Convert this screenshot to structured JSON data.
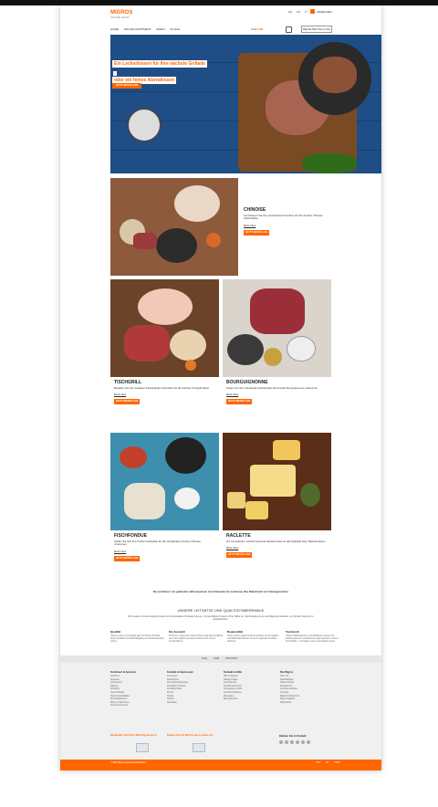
{
  "header": {
    "logo": "MIGROS",
    "logo_sub": "ONLINE-SHOP",
    "languages": [
      "DE",
      "FR",
      "IT"
    ],
    "login": "ANMELDEN",
    "nav": [
      "HOME",
      "ONLINE-SORTIMENT",
      "IDEEN",
      "FILIALE"
    ],
    "vat_label": "Total",
    "vat_value": "0.00",
    "cart_count": "0",
    "store_button": "MEINE BESTELLUNG"
  },
  "hero": {
    "title_line1": "Ein Leckerbissen für Ihre nächste Grillade",
    "title_line2": "oder ein feines Abendessen",
    "arrow": "›",
    "button": "JETZT BESTELLEN"
  },
  "feature": {
    "title": "CHINOISE",
    "desc": "Kombinieren Sie Ihre persönlichen Favoriten für Ihre Fondue Chinoise Fleischplatte.",
    "more": "Mehr Infos",
    "button": "JETZT BESTELLEN"
  },
  "cards": [
    {
      "title": "TISCHGRILL",
      "desc": "Bestellen Sie Ihre perfekten Fleischplatte nach Mass für die nächste Tischgrill-Party!",
      "more": "Mehr Infos",
      "button": "JETZT BESTELLEN"
    },
    {
      "title": "BOURGUIGNONNE",
      "desc": "Stellen Sie Ihre individuelle Fleischplatte fürs Fondue Bourguignonne zusammen.",
      "more": "Mehr Infos",
      "button": "JETZT BESTELLEN"
    },
    {
      "title": "FISCHFONDUE",
      "desc": "Stellen Sie sich Ihre frische Fischplatte für die einzigartiges Fondue Chinoise zusammen.",
      "more": "Mehr Infos",
      "button": "JETZT BESTELLEN"
    },
    {
      "title": "RACLETTE",
      "desc": "Zur aromatische, weltschmelzende Raclette-Käse ist das Highlight beim Raclette-Essen.",
      "more": "Mehr Infos",
      "button": "JETZT BESTELLEN"
    }
  ],
  "note": "Sie profitieren von geltenden Aktionspreisen zum Zeitpunkt der Lieferung. Das Rabatt wird erst hinzugerechnet.",
  "values_section": {
    "title": "UNSERE LEITSÄTZE UND QUALITÄTSMERKMALE",
    "desc": "Mit unserem Online-Angebot bieten wir verschiedene Produkte fürs an, mit das Migros Vorteil in Ihrer Nähe an. Gleichzeitig ist uns auf folgende Leitsätze, um Kunden Service zu gewährleisten.",
    "items": [
      {
        "title": "Qualität",
        "desc": "Unsere Liebe zum Produkt geht mit frische Produkt, bester Qualität und Nachhaltigkeit pro Verkaufsstandort einher."
      },
      {
        "title": "Die Auswahl",
        "desc": "Wir bieten neben den besten Preis-Leistungs-Verhältnis auch als möglichst grosses Sortiment für unsere Kundschaft an."
      },
      {
        "title": "Regionalität",
        "desc": "Viele unserer engen Zusammenarbeit mit der lokalen Landwirtschaft können wir auch regionale Produkte anbieten."
      },
      {
        "title": "Teamwork",
        "desc": "Unsere Mitarbeitenden und Mitarbeiter werden mit Fachkompetenz und Menschen das Vertrauen unserer Kundschaft – und tragen unsere Grundsätze weiter."
      }
    ]
  },
  "midbar": {
    "links": [
      "FAQ",
      "AGB",
      "KONTAKT"
    ]
  },
  "footer": {
    "columns": [
      {
        "title": "Sortiment & Services",
        "items": [
          "Sortiment",
          "Angebote",
          "Lieferservice",
          "Zahlung",
          "Abholung",
          "Geschenkkarte",
          "Fleisch Spezialitäten",
          "Brot & Backwaren",
          "Weine & Spirituosen",
          "Früchte & Gemüse"
        ]
      },
      {
        "title": "Kontakt & Impressum",
        "items": [
          "Impressum",
          "Datenschutz",
          "Nutzungsbedingungen",
          "Rechtliche Hinweise",
          "Kontaktformular",
          "Presse",
          "Medien",
          "Karriere",
          "Newsletter"
        ]
      },
      {
        "title": "Kontakt & Hilfe",
        "items": [
          "Hilfe & Support",
          "Häufige Fragen",
          "Kundendienst",
          "Kontakt aufnehmen",
          "Anregungen & Kritik",
          "Lieferinformationen",
          "Rückgaben",
          "Barrierefreiheit"
        ]
      },
      {
        "title": "Die Migros",
        "items": [
          "Über uns",
          "Nachhaltigkeit",
          "Migros-Gruppe",
          "Engagement",
          "Genossenschaften",
          "Cumulus",
          "Migros-Kulturprozent",
          "Migros Magazin",
          "Migros-Blog"
        ]
      }
    ],
    "promo1": "Migipedia: Jetzt Ihre Meinung äussern",
    "promo2": "Kaufen Sie bei Migros auch online ein",
    "social_title": "Bleiben Sie in Kontakt",
    "copyright": "© 2023 Migros-Genossenschafts-Bund",
    "payments": [
      "VISA",
      "MC",
      "TWINT"
    ]
  },
  "colors": {
    "accent": "#ff6600",
    "hero_bg": "#1f4d86"
  }
}
